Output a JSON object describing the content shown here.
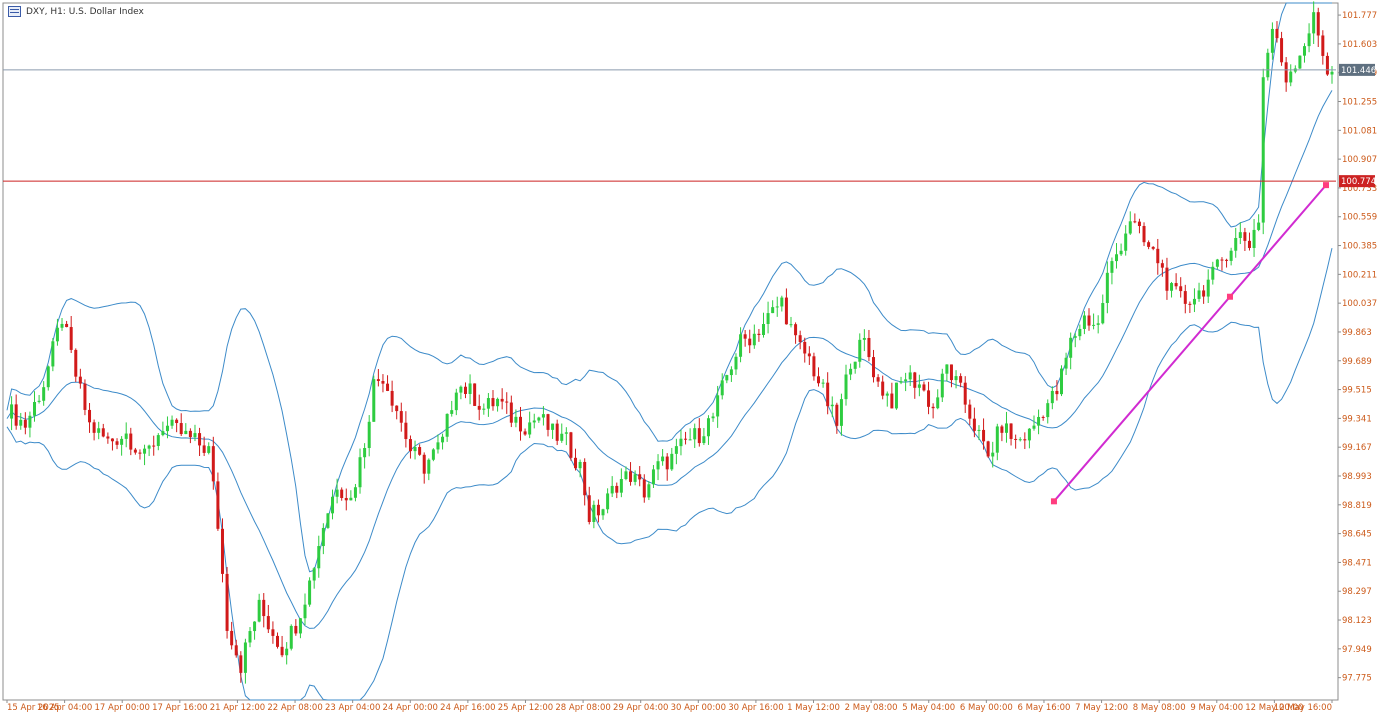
{
  "header": {
    "title": "DXY, H1:  U.S. Dollar Index"
  },
  "colors": {
    "bull": "#2ecc40",
    "bear": "#d11a1a",
    "bands": "#3d8bc9",
    "current_line": "#8a9aae",
    "resistance_line": "#cc2222",
    "trendline": "#d12bd1",
    "trend_point": "#ff3d7f",
    "axis": "#cc5a1a"
  },
  "chart_data": {
    "type": "candlestick",
    "symbol": "DXY",
    "timeframe": "H1",
    "ylim": [
      97.64,
      101.85
    ],
    "y_ticks": [
      "101.777",
      "101.603",
      "101.429",
      "101.255",
      "101.081",
      "100.907",
      "100.733",
      "100.559",
      "100.385",
      "100.211",
      "100.037",
      "99.863",
      "99.689",
      "99.515",
      "99.341",
      "99.167",
      "98.993",
      "98.819",
      "98.645",
      "98.471",
      "98.297",
      "98.123",
      "97.949",
      "97.775"
    ],
    "x_labels": [
      "15 Apr 2025",
      "16 Apr 04:00",
      "17 Apr 00:00",
      "17 Apr 16:00",
      "21 Apr 12:00",
      "22 Apr 08:00",
      "23 Apr 04:00",
      "24 Apr 00:00",
      "24 Apr 16:00",
      "25 Apr 12:00",
      "28 Apr 08:00",
      "29 Apr 04:00",
      "30 Apr 00:00",
      "30 Apr 16:00",
      "1 May 12:00",
      "2 May 08:00",
      "5 May 04:00",
      "6 May 00:00",
      "6 May 16:00",
      "7 May 12:00",
      "8 May 08:00",
      "9 May 04:00",
      "12 May 00:00",
      "12 May 16:00"
    ],
    "current_price": "101.446",
    "resistance_price": "100.774",
    "price_path": [
      [
        0,
        99.4
      ],
      [
        4,
        99.3
      ],
      [
        8,
        99.55
      ],
      [
        12,
        99.95
      ],
      [
        15,
        99.6
      ],
      [
        18,
        99.3
      ],
      [
        22,
        99.2
      ],
      [
        26,
        99.25
      ],
      [
        30,
        99.1
      ],
      [
        34,
        99.3
      ],
      [
        38,
        99.25
      ],
      [
        41,
        99.2
      ],
      [
        44,
        99.15
      ],
      [
        46,
        98.7
      ],
      [
        48,
        98.1
      ],
      [
        51,
        97.85
      ],
      [
        53,
        98.05
      ],
      [
        55,
        98.2
      ],
      [
        58,
        98.05
      ],
      [
        60,
        97.95
      ],
      [
        63,
        98.1
      ],
      [
        66,
        98.35
      ],
      [
        69,
        98.7
      ],
      [
        72,
        98.95
      ],
      [
        75,
        98.85
      ],
      [
        78,
        99.2
      ],
      [
        80,
        99.55
      ],
      [
        82,
        99.6
      ],
      [
        85,
        99.4
      ],
      [
        88,
        99.15
      ],
      [
        91,
        99.05
      ],
      [
        95,
        99.2
      ],
      [
        98,
        99.55
      ],
      [
        101,
        99.5
      ],
      [
        104,
        99.4
      ],
      [
        107,
        99.45
      ],
      [
        110,
        99.35
      ],
      [
        113,
        99.3
      ],
      [
        116,
        99.35
      ],
      [
        119,
        99.25
      ],
      [
        122,
        99.2
      ],
      [
        125,
        99.05
      ],
      [
        127,
        98.75
      ],
      [
        130,
        98.8
      ],
      [
        133,
        98.95
      ],
      [
        136,
        99.0
      ],
      [
        139,
        98.9
      ],
      [
        142,
        99.05
      ],
      [
        145,
        99.1
      ],
      [
        148,
        99.2
      ],
      [
        151,
        99.25
      ],
      [
        154,
        99.35
      ],
      [
        157,
        99.6
      ],
      [
        160,
        99.8
      ],
      [
        163,
        99.85
      ],
      [
        166,
        99.95
      ],
      [
        169,
        100.05
      ],
      [
        172,
        99.8
      ],
      [
        175,
        99.7
      ],
      [
        178,
        99.5
      ],
      [
        181,
        99.3
      ],
      [
        184,
        99.7
      ],
      [
        187,
        99.8
      ],
      [
        190,
        99.55
      ],
      [
        193,
        99.45
      ],
      [
        196,
        99.6
      ],
      [
        199,
        99.55
      ],
      [
        202,
        99.4
      ],
      [
        205,
        99.65
      ],
      [
        208,
        99.5
      ],
      [
        211,
        99.3
      ],
      [
        214,
        99.1
      ],
      [
        217,
        99.3
      ],
      [
        220,
        99.2
      ],
      [
        223,
        99.25
      ],
      [
        226,
        99.4
      ],
      [
        229,
        99.5
      ],
      [
        232,
        99.8
      ],
      [
        235,
        99.95
      ],
      [
        238,
        99.9
      ],
      [
        240,
        100.2
      ],
      [
        243,
        100.4
      ],
      [
        245,
        100.55
      ],
      [
        248,
        100.4
      ],
      [
        251,
        100.3
      ],
      [
        254,
        100.1
      ],
      [
        257,
        100.05
      ],
      [
        260,
        100.1
      ],
      [
        263,
        100.2
      ],
      [
        266,
        100.35
      ],
      [
        269,
        100.45
      ],
      [
        271,
        100.4
      ],
      [
        273,
        100.55
      ],
      [
        274,
        101.4
      ],
      [
        276,
        101.7
      ],
      [
        279,
        101.4
      ],
      [
        282,
        101.55
      ],
      [
        285,
        101.75
      ],
      [
        288,
        101.45
      ]
    ],
    "trendline": {
      "from": [
        "6 May 16:00",
        98.84
      ],
      "to": [
        "12 May 16:00",
        100.75
      ]
    }
  }
}
